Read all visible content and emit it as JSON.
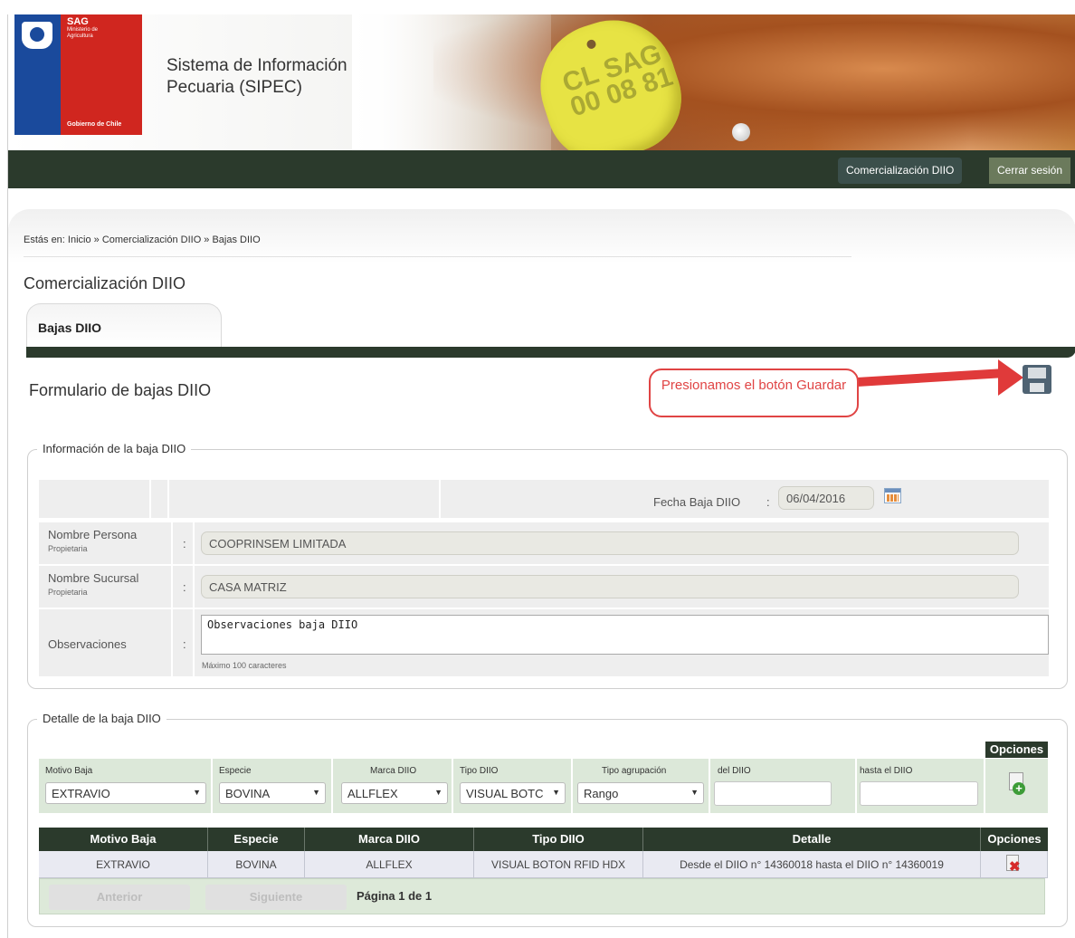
{
  "header": {
    "logo": {
      "brand": "SAG",
      "ministry": "Ministerio de Agricultura",
      "government": "Gobierno de Chile"
    },
    "app_title": "Sistema de Información Pecuaria (SIPEC)",
    "tag_text": "CL SAG 00 08 81"
  },
  "nav": {
    "comercializacion": "Comercialización DIIO",
    "cerrar_sesion": "Cerrar sesión"
  },
  "breadcrumb": "Estás en: Inicio » Comercialización DIIO » Bajas DIIO",
  "section_title": "Comercialización DIIO",
  "tab_label": "Bajas DIIO",
  "form_title": "Formulario de bajas DIIO",
  "annotation": "Presionamos el botón Guardar",
  "info": {
    "legend": "Información de la baja DIIO",
    "fecha_label": "Fecha Baja DIIO",
    "fecha_value": "06/04/2016",
    "nombre_persona_label": "Nombre Persona",
    "nombre_persona_sub": "Propietaria",
    "nombre_persona_value": "COOPRINSEM LIMITADA",
    "nombre_sucursal_label": "Nombre Sucursal",
    "nombre_sucursal_sub": "Propietaria",
    "nombre_sucursal_value": "CASA MATRIZ",
    "observaciones_label": "Observaciones",
    "observaciones_value": "Observaciones baja DIIO",
    "observaciones_hint": "Máximo 100 caracteres",
    "colon": ":"
  },
  "detalle": {
    "legend": "Detalle de la baja DIIO",
    "filters": {
      "motivo_label": "Motivo Baja",
      "motivo_value": "EXTRAVIO",
      "especie_label": "Especie",
      "especie_value": "BOVINA",
      "marca_label": "Marca DIIO",
      "marca_value": "ALLFLEX",
      "tipo_label": "Tipo DIIO",
      "tipo_value": "VISUAL BOTC",
      "agrupacion_label": "Tipo agrupación",
      "agrupacion_value": "Rango",
      "del_label": "del DIIO",
      "hasta_label": "hasta el DIIO",
      "opciones_label": "Opciones"
    },
    "table": {
      "headers": [
        "Motivo Baja",
        "Especie",
        "Marca DIIO",
        "Tipo DIIO",
        "Detalle",
        "Opciones"
      ],
      "rows": [
        [
          "EXTRAVIO",
          "BOVINA",
          "ALLFLEX",
          "VISUAL BOTON RFID HDX",
          "Desde el DIIO n° 14360018 hasta el DIIO n° 14360019"
        ]
      ]
    },
    "pager": {
      "prev": "Anterior",
      "next": "Siguiente",
      "info": "Página 1 de 1"
    }
  },
  "icons": {
    "save": "floppy-disk-icon",
    "calendar": "calendar-icon",
    "add": "add-document-icon",
    "delete": "delete-document-icon"
  },
  "colors": {
    "dark_green": "#2b3a2c",
    "annotation_red": "#e04444",
    "filter_bg": "#dce8d9",
    "row_bg": "#e9eaf2"
  }
}
